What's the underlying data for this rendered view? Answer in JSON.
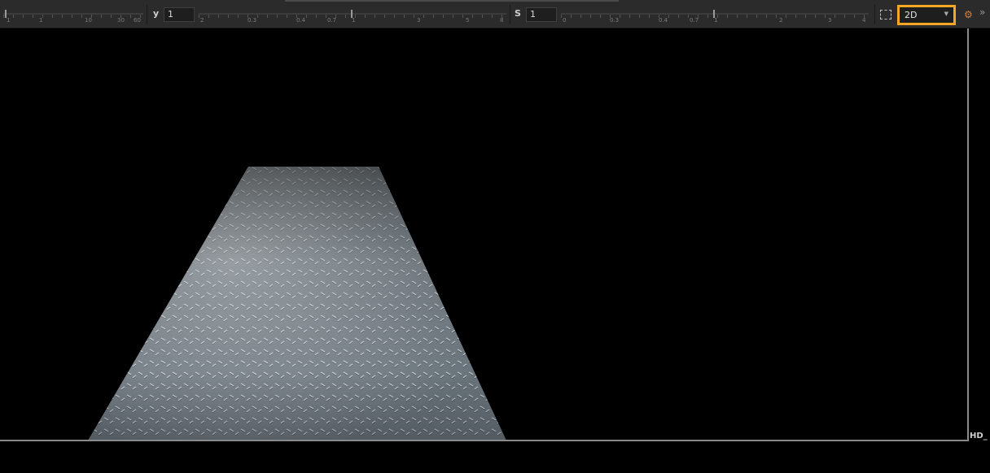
{
  "toolbar": {
    "x_ruler_labels": [
      "1",
      "1",
      "10",
      "30",
      "60"
    ],
    "y_param": {
      "label": "y",
      "value": "1"
    },
    "y_ruler_labels": [
      "2",
      "0.3",
      "0.4",
      "0.7",
      "1",
      "3",
      "5",
      "8"
    ],
    "s_param": {
      "label": "S",
      "value": "1"
    },
    "s_ruler_labels": [
      "0",
      "0.3",
      "0.4",
      "0.7",
      "1",
      "2",
      "3",
      "4"
    ],
    "roi_icon": "roi-icon",
    "view_mode": {
      "selected": "2D",
      "highlight_color": "#f5a623"
    },
    "paint_icon": "paint-icon",
    "more_icon": "double-chevron-down-icon"
  },
  "viewer": {
    "format_label": "HD_",
    "background": "#000000",
    "format_box_color": "#8a8a8a"
  }
}
